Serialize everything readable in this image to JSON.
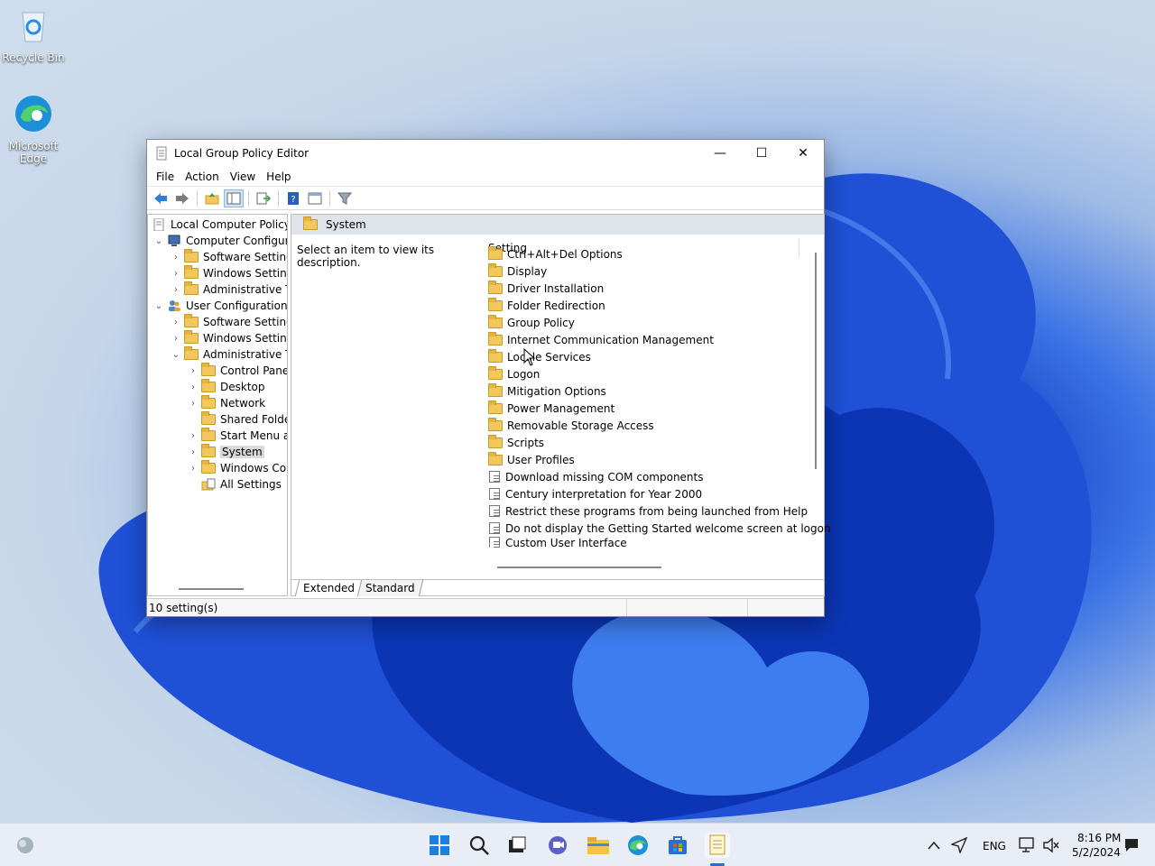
{
  "desktop": {
    "recycle_bin": "Recycle Bin",
    "edge_line1": "Microsoft",
    "edge_line2": "Edge"
  },
  "window": {
    "title": "Local Group Policy Editor",
    "controls": {
      "minimize": "—",
      "maximize": "☐",
      "close": "✕"
    }
  },
  "menu": [
    "File",
    "Action",
    "View",
    "Help"
  ],
  "tree": {
    "root": "Local Computer Policy",
    "computer_config": "Computer Configura",
    "cc_software": "Software Settings",
    "cc_windows": "Windows Setting",
    "cc_admin": "Administrative Te",
    "user_config": "User Configuration",
    "uc_software": "Software Settings",
    "uc_windows": "Windows Setting",
    "uc_admin": "Administrative Te",
    "control_panel": "Control Panel",
    "desktop": "Desktop",
    "network": "Network",
    "shared_folders": "Shared Folder",
    "start_menu": "Start Menu ar",
    "system": "System",
    "windows_components": "Windows Cor",
    "all_settings": "All Settings"
  },
  "right_pane": {
    "header": "System",
    "description": "Select an item to view its description.",
    "column": "Setting",
    "folders": [
      "Ctrl+Alt+Del Options",
      "Display",
      "Driver Installation",
      "Folder Redirection",
      "Group Policy",
      "Internet Communication Management",
      "Locale Services",
      "Logon",
      "Mitigation Options",
      "Power Management",
      "Removable Storage Access",
      "Scripts",
      "User Profiles"
    ],
    "settings": [
      "Download missing COM components",
      "Century interpretation for Year 2000",
      "Restrict these programs from being launched from Help",
      "Do not display the Getting Started welcome screen at logon",
      "Custom User Interface"
    ],
    "tab_extended": "Extended",
    "tab_standard": "Standard"
  },
  "status": "10 setting(s)",
  "tray": {
    "lang": "ENG",
    "time": "8:16 PM",
    "date": "5/2/2024"
  }
}
